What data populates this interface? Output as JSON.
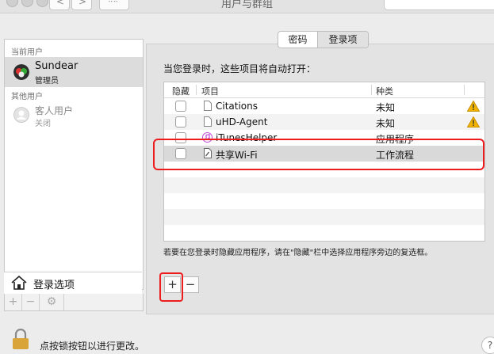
{
  "window": {
    "title": "用户与群组"
  },
  "toolbar": {
    "back": "<",
    "forward": ">",
    "grid": "⠿⠿"
  },
  "users": {
    "current_label": "当前用户",
    "current_user": {
      "name": "Sundear",
      "role": "管理员"
    },
    "other_label": "其他用户",
    "guest_user": {
      "name": "客人用户",
      "status": "关闭"
    },
    "login_options_label": "登录选项",
    "add": "+",
    "remove": "−",
    "gear": "⚙"
  },
  "tabs": [
    {
      "label": "密码",
      "active": false
    },
    {
      "label": "登录项",
      "active": true
    }
  ],
  "login_items": {
    "intro": "当您登录时，这些项目将自动打开：",
    "columns": {
      "hide": "隐藏",
      "item": "项目",
      "kind": "种类"
    },
    "rows": [
      {
        "name": "Citations",
        "kind": "未知",
        "warning": true
      },
      {
        "name": "uHD-Agent",
        "kind": "未知",
        "warning": true
      },
      {
        "name": "iTunesHelper",
        "kind": "应用程序",
        "warning": false
      },
      {
        "name": "共享Wi-Fi",
        "kind": "工作流程",
        "warning": false
      }
    ],
    "hint": "若要在您登录时隐藏应用程序，请在\"隐藏\"栏中选择应用程序旁边的复选框。",
    "add": "+",
    "remove": "−"
  },
  "footer": {
    "lock_text": "点按锁按钮以进行更改。",
    "help": "?"
  },
  "colors": {
    "highlight": "#ee1c1c",
    "warning": "#f0b400",
    "selection": "#d9d9d9"
  }
}
